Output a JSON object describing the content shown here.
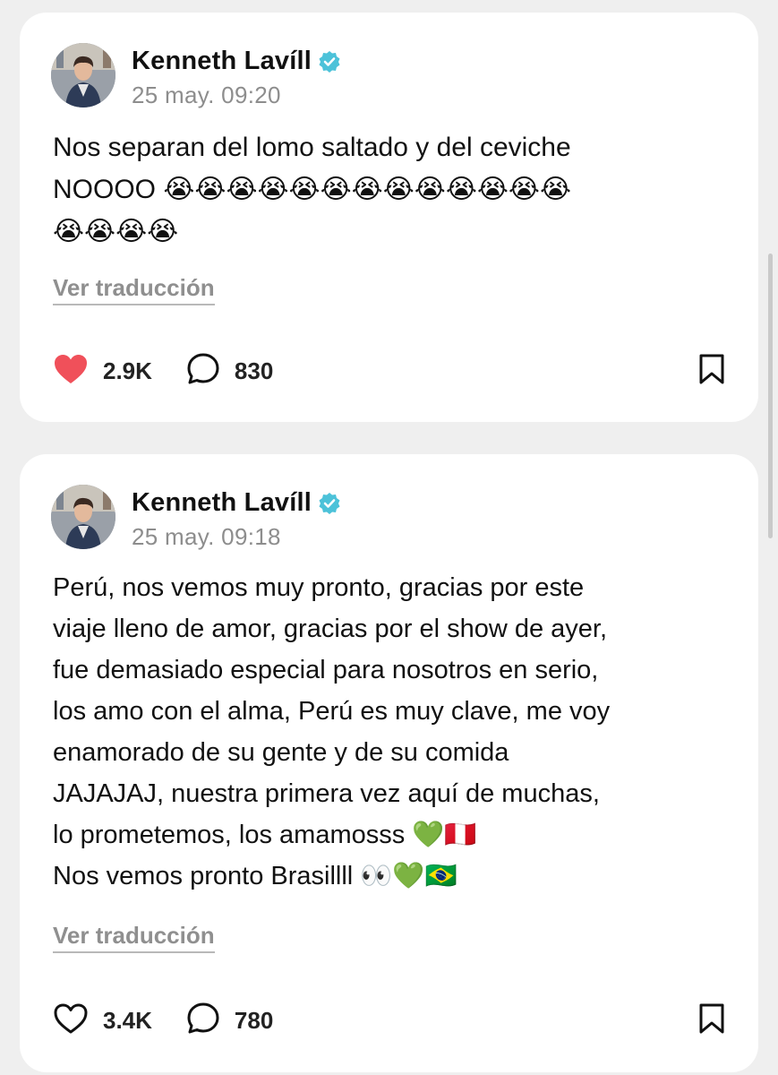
{
  "posts": [
    {
      "author": "Kenneth Lavíll",
      "time": "25 may. 09:20",
      "text": "Nos separan del lomo saltado y del ceviche\nNOOOO 😭😭😭😭😭😭😭😭😭😭😭😭😭\n😭😭😭😭",
      "translate_label": "Ver traducción",
      "likes": "2.9K",
      "liked": true,
      "comments": "830"
    },
    {
      "author": "Kenneth Lavíll",
      "time": "25 may. 09:18",
      "text": "Perú, nos vemos muy pronto, gracias por este\nviaje lleno de amor, gracias por el show de ayer,\nfue demasiado especial para nosotros en serio,\nlos amo con el alma, Perú es muy clave, me voy\nenamorado de su gente y de su comida\nJAJAJAJ, nuestra primera vez aquí de muchas,\nlo prometemos, los amamosss 💚🇵🇪\nNos vemos pronto Brasillll 👀💚🇧🇷",
      "translate_label": "Ver traducción",
      "likes": "3.4K",
      "liked": false,
      "comments": "780"
    }
  ],
  "colors": {
    "like_active": "#f0505a",
    "verified": "#4cc2d9",
    "muted_text": "#8d8d8d"
  },
  "icons": [
    "verified-badge-icon",
    "heart-icon",
    "comment-bubble-icon",
    "bookmark-icon"
  ]
}
